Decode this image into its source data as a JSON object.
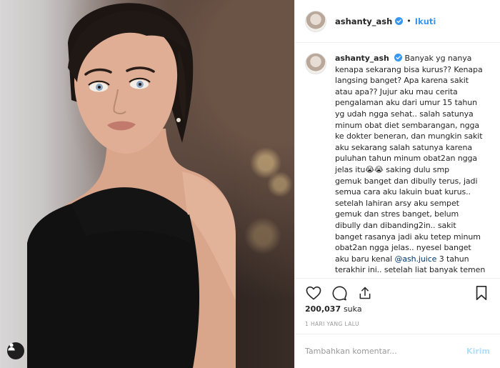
{
  "post": {
    "username": "ashanty_ash",
    "follow_separator": "•",
    "follow_label": "Ikuti",
    "verified_icon": "verified-badge-icon",
    "caption_lines": [
      "Banyak yg nanya",
      "kenapa sekarang bisa kurus?? Kenapa",
      "langsing banget? Apa karena sakit",
      "atau apa?? Jujur aku mau cerita",
      "pengalaman aku dari umur 15 tahun",
      "yg udah ngga sehat.. salah satunya",
      "minum obat diet sembarangan, ngga",
      "ke dokter beneran, dan mungkin sakit",
      "aku sekarang salah satunya karena",
      "puluhan tahun minum obat2an ngga",
      "jelas itu😭😭 saking dulu smp",
      "gemuk banget dan dibully terus, jadi",
      "semua cara aku lakuin buat kurus..",
      "setelah lahiran arsy aku sempet",
      "gemuk dan stres banget, belum",
      "dibully dan dibanding2in.. sakit",
      "banget rasanya jadi aku tetep minum",
      "obat2an ngga jelas.. nyesel banget",
      "aku baru kenal ",
      "terakhir ini.. setelah liat banyak temen"
    ],
    "mention": "@ash.juice",
    "mention_suffix": " 3 tahun",
    "likes_count": "200,037",
    "likes_label": "suka",
    "timestamp": "1 HARI YANG LALU",
    "comment_placeholder": "Tambahkan komentar...",
    "post_label": "Kirim"
  },
  "colors": {
    "link_blue": "#3897f0",
    "post_disabled": "#b2dffc",
    "muted": "#999999",
    "text": "#262626"
  },
  "icons": {
    "like": "heart-icon",
    "comment": "comment-bubble-icon",
    "share": "share-arrow-icon",
    "save": "bookmark-icon",
    "tag": "user-tag-icon"
  }
}
